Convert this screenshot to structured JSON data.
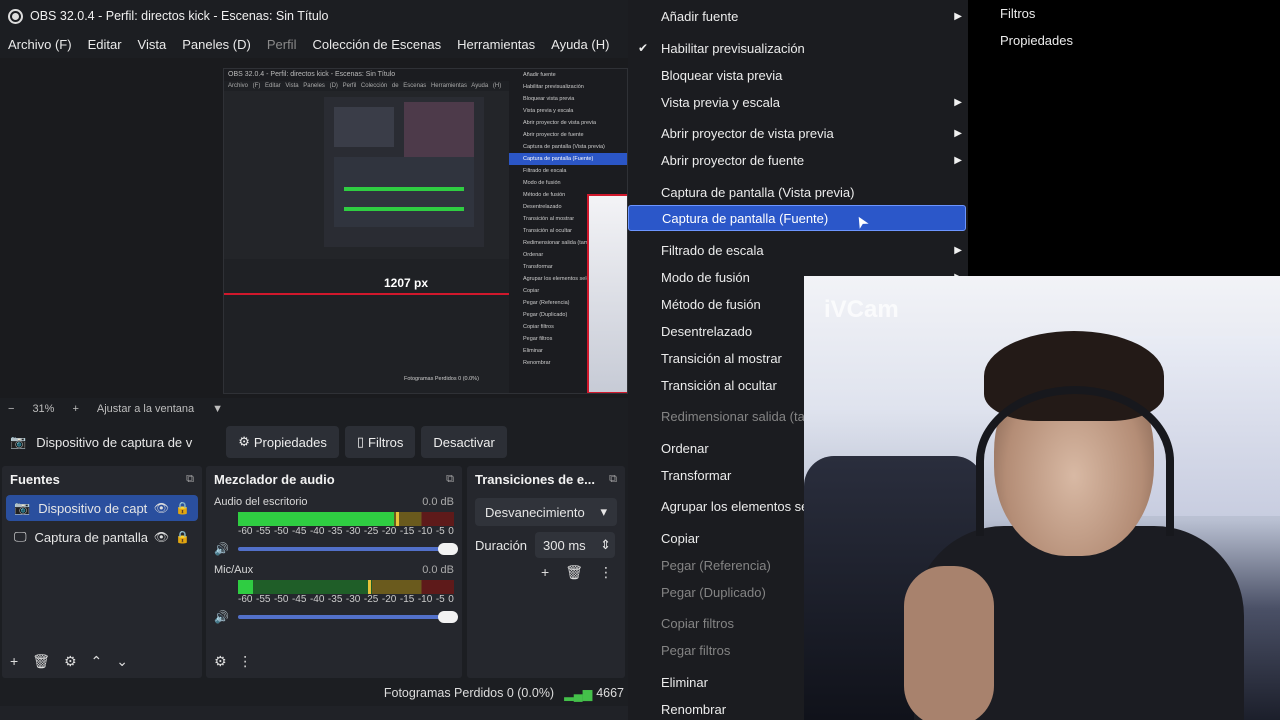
{
  "window": {
    "title": "OBS 32.0.4 - Perfil: directos kick - Escenas: Sin Título"
  },
  "menubar": [
    "Archivo (F)",
    "Editar",
    "Vista",
    "Paneles (D)",
    "Perfil",
    "Colección de Escenas",
    "Herramientas",
    "Ayuda (H)"
  ],
  "nested_preview": {
    "title": "OBS 32.0.4 - Perfil: directos kick - Escenas: Sin Título",
    "menu": "Archivo (F)  Editar  Vista  Paneles (D)  Perfil  Colección de Escenas  Herramientas  Ayuda (H)",
    "pixels_label": "1207 px",
    "footer": "Fotogramas Perdidos 0 (0.0%)",
    "context_items": [
      "Añadir fuente",
      "Habilitar previsualización",
      "Bloquear vista previa",
      "Vista previa y escala",
      "Abrir proyector de vista previa",
      "Abrir proyector de fuente",
      "Captura de pantalla (Vista previa)",
      "Captura de pantalla (Fuente)",
      "Filtrado de escala",
      "Modo de fusión",
      "Método de fusión",
      "Desentrelazado",
      "Transición al mostrar",
      "Transición al ocultar",
      "Redimensionar salida (tamaño)",
      "Ordenar",
      "Transformar",
      "Agrupar los elementos seleccionados",
      "Copiar",
      "Pegar (Referencia)",
      "Pegar (Duplicado)",
      "Copiar filtros",
      "Pegar filtros",
      "Eliminar",
      "Renombrar"
    ]
  },
  "zoom": {
    "minus": "−",
    "percent": "31%",
    "plus": "+",
    "fit": "Ajustar a la ventana",
    "dropdown": "▼"
  },
  "source_toolbar": {
    "source_name": "Dispositivo de captura de v",
    "properties": "Propiedades",
    "filters": "Filtros",
    "deactivate": "Desactivar"
  },
  "sources_dock": {
    "title": "Fuentes",
    "items": [
      {
        "name": "Dispositivo de captura",
        "selected": true
      },
      {
        "name": "Captura de pantalla",
        "selected": false
      }
    ]
  },
  "mixer_dock": {
    "title": "Mezclador de audio",
    "channels": [
      {
        "name": "Audio del escritorio",
        "db": "0.0 dB",
        "level": 0.72,
        "peak": 0.73
      },
      {
        "name": "Mic/Aux",
        "db": "0.0 dB",
        "level": 0.07,
        "peak": 0.6
      }
    ],
    "scale": [
      "-60",
      "-55",
      "-50",
      "-45",
      "-40",
      "-35",
      "-30",
      "-25",
      "-20",
      "-15",
      "-10",
      "-5",
      "0"
    ]
  },
  "transitions_dock": {
    "title": "Transiciones de e...",
    "selected": "Desvanecimiento",
    "duration_label": "Duración",
    "duration_value": "300 ms"
  },
  "status": {
    "dropped_frames": "Fotogramas Perdidos 0 (0.0%)",
    "kbps": "4667"
  },
  "context_menu": {
    "items": [
      {
        "label": "Añadir fuente",
        "submenu": true,
        "state": "normal"
      },
      {
        "label": "Habilitar previsualización",
        "checked": true,
        "state": "normal"
      },
      {
        "label": "Bloquear vista previa",
        "state": "normal"
      },
      {
        "label": "Vista previa y escala",
        "submenu": true,
        "state": "normal"
      },
      {
        "label": "Abrir proyector de vista previa",
        "submenu": true,
        "state": "normal"
      },
      {
        "label": "Abrir proyector de fuente",
        "submenu": true,
        "state": "normal"
      },
      {
        "label": "Captura de pantalla (Vista previa)",
        "state": "normal"
      },
      {
        "label": "Captura de pantalla (Fuente)",
        "state": "selected"
      },
      {
        "label": "Filtrado de escala",
        "submenu": true,
        "state": "normal"
      },
      {
        "label": "Modo de fusión",
        "submenu": true,
        "state": "normal"
      },
      {
        "label": "Método de fusión",
        "state": "normal"
      },
      {
        "label": "Desentrelazado",
        "state": "normal"
      },
      {
        "label": "Transición al mostrar",
        "state": "normal"
      },
      {
        "label": "Transición al ocultar",
        "state": "normal"
      },
      {
        "label": "Redimensionar salida (tar",
        "state": "disabled"
      },
      {
        "label": "Ordenar",
        "state": "normal"
      },
      {
        "label": "Transformar",
        "state": "normal"
      },
      {
        "label": "Agrupar los elementos se",
        "state": "normal"
      },
      {
        "label": "Copiar",
        "state": "normal"
      },
      {
        "label": "Pegar (Referencia)",
        "state": "disabled"
      },
      {
        "label": "Pegar (Duplicado)",
        "state": "disabled"
      },
      {
        "label": "Copiar filtros",
        "state": "disabled"
      },
      {
        "label": "Pegar filtros",
        "state": "disabled"
      },
      {
        "label": "Eliminar",
        "state": "normal"
      },
      {
        "label": "Renombrar",
        "state": "normal"
      }
    ]
  },
  "submenu": {
    "items": [
      "Filtros",
      "Propiedades"
    ]
  },
  "webcam": {
    "watermark": "iVCam"
  },
  "colors": {
    "selection": "#2b57c9",
    "obs_bg": "#1c1e22",
    "highlight_border": "#d0182c"
  }
}
